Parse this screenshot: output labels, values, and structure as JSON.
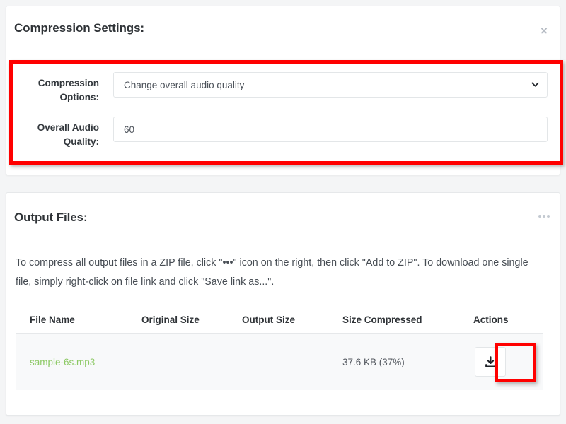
{
  "settings_panel": {
    "title": "Compression Settings:",
    "close_label": "×",
    "close_icon": "close-icon",
    "fields": [
      {
        "label": "Compression Options:",
        "value": "Change overall audio quality",
        "type": "select",
        "icon": "chevron-down-icon"
      },
      {
        "label": "Overall Audio Quality:",
        "value": "60",
        "type": "text",
        "placeholder": ""
      }
    ]
  },
  "output_panel": {
    "title": "Output Files:",
    "menu_icon": "ellipsis-horizontal-icon",
    "description": "To compress all output files in a ZIP file, click \"•••\" icon on the right, then click \"Add to ZIP\". To download one single file, simply right-click on file link and click \"Save link as...\".",
    "table": {
      "columns": [
        "File Name",
        "Original Size",
        "Output Size",
        "Size Compressed",
        "Actions"
      ],
      "rows": [
        {
          "file_name": "sample-6s.mp3",
          "original_size": "",
          "output_size": "",
          "size_compressed": "37.6 KB (37%)",
          "action_icon": "download-icon"
        }
      ]
    }
  },
  "annotations": {
    "highlight_color": "#ff0000",
    "boxes": [
      "compression-settings-fields",
      "download-action-button"
    ]
  },
  "colors": {
    "page_background": "#f4f5f6",
    "card_background": "#ffffff",
    "file_link": "#8dc965",
    "heading": "#2f3337",
    "body_text": "#474d54",
    "muted_icon": "#c3c9d1"
  }
}
